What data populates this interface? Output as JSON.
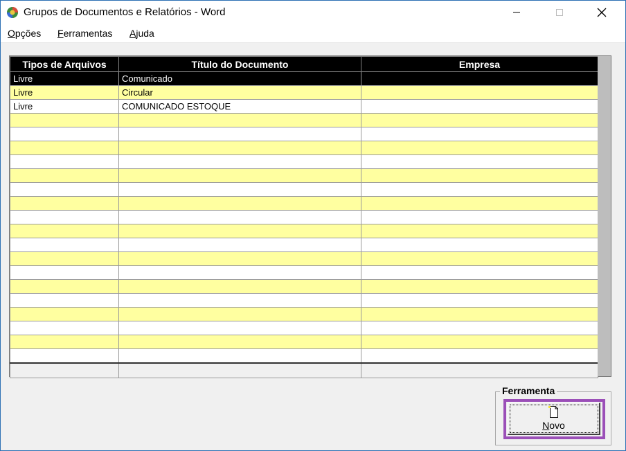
{
  "window": {
    "title": "Grupos de Documentos e Relatórios - Word",
    "icon": "app-globe-icon",
    "controls": {
      "minimize": "minimize-icon",
      "maximize": "maximize-icon",
      "close": "close-icon"
    }
  },
  "menu": {
    "items": [
      {
        "label": "Opções",
        "mnemonic": "O",
        "rest": "pções"
      },
      {
        "label": "Ferramentas",
        "mnemonic": "F",
        "rest": "erramentas"
      },
      {
        "label": "Ajuda",
        "mnemonic": "A",
        "rest": "juda"
      }
    ]
  },
  "grid": {
    "columns": [
      "Tipos de Arquivos",
      "Título do Documento",
      "Empresa"
    ],
    "rows": [
      {
        "tipo": "Livre",
        "titulo": "Comunicado",
        "empresa": "",
        "selected": true
      },
      {
        "tipo": "Livre",
        "titulo": "Circular",
        "empresa": ""
      },
      {
        "tipo": "Livre",
        "titulo": "COMUNICADO ESTOQUE",
        "empresa": ""
      }
    ],
    "empty_rows": 18,
    "colors": {
      "header_bg": "#000000",
      "row_alt": "#ffffa0",
      "row": "#ffffff",
      "selected": "#000000"
    }
  },
  "tools": {
    "group_label": "Ferramenta",
    "novo": {
      "label": "Novo",
      "mnemonic": "N",
      "rest": "ovo",
      "icon": "new-document-icon",
      "highlight": "#9b4fb8"
    }
  }
}
